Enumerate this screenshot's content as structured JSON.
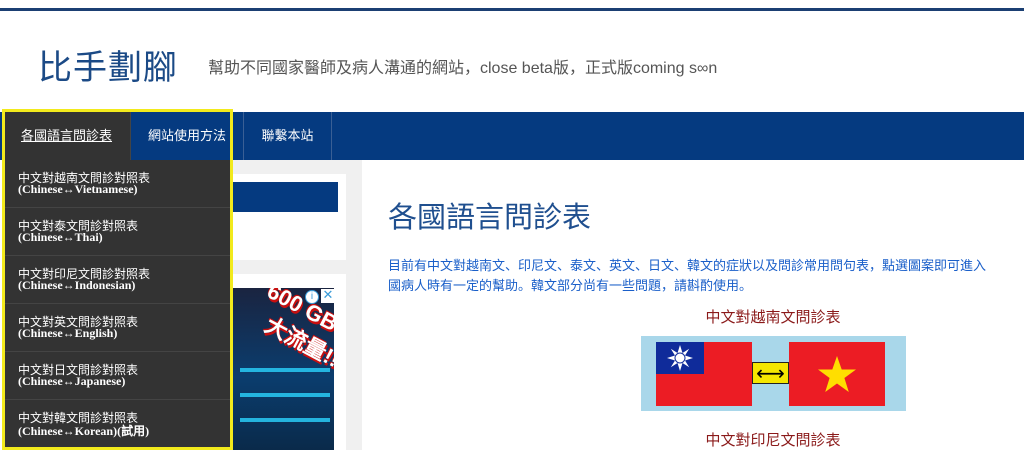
{
  "header": {
    "site_title": "比手劃腳",
    "tagline": "幫助不同國家醫師及病人溝通的網站，close beta版，正式版coming s∞n"
  },
  "nav": {
    "items": [
      {
        "label": "各國語言問診表",
        "active": true
      },
      {
        "label": "網站使用方法",
        "active": false
      },
      {
        "label": "聯繫本站",
        "active": false
      }
    ]
  },
  "dropdown": {
    "items": [
      {
        "title": "中文對越南文問診對照表",
        "subtitle": "(Chinese↔Vietnamese)"
      },
      {
        "title": "中文對泰文問診對照表",
        "subtitle": "(Chinese↔Thai)"
      },
      {
        "title": "中文對印尼文問診對照表",
        "subtitle": "(Chinese↔Indonesian)"
      },
      {
        "title": "中文對英文問診對照表",
        "subtitle": "(Chinese↔English)"
      },
      {
        "title": "中文對日文問診對照表",
        "subtitle": "(Chinese↔Japanese)"
      },
      {
        "title": "中文對韓文問診對照表",
        "subtitle": "(Chinese↔Korean)(試用)"
      }
    ]
  },
  "ad": {
    "headline": "600 GB",
    "subline": "大流量!!",
    "info_icon": "info-icon",
    "close_icon": "close-icon"
  },
  "main": {
    "title": "各國語言問診表",
    "intro_line1": "目前有中文對越南文、印尼文、泰文、英文、日文、韓文的症狀以及問診常用問句表，點選圖案即可進入",
    "intro_line2": "國病人時有一定的幫助。韓文部分尚有一些問題，請斟酌使用。",
    "sections": [
      {
        "heading": "中文對越南文問診表"
      },
      {
        "heading": "中文對印尼文問診表"
      }
    ],
    "flag_arrow": "⟷"
  },
  "colors": {
    "brand_blue": "#053a80",
    "dropdown_bg": "#333333",
    "highlight_yellow": "#f2ea1c",
    "heading_red": "#8b1a1a",
    "flag_red": "#ec1c24"
  }
}
